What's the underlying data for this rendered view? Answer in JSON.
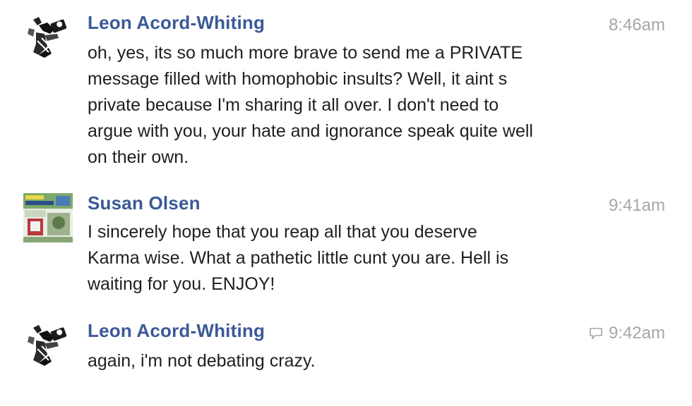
{
  "messages": [
    {
      "sender": "Leon Acord-Whiting",
      "time": "8:46am",
      "avatar_icon": "man-with-camera-icon",
      "lines": [
        "oh, yes, its so much more brave to send me a PRIVATE",
        "message filled with homophobic insults? Well, it aint s",
        "private because I'm sharing it all over. I don't need to",
        "argue with you, your hate and ignorance speak quite well",
        "on their own."
      ]
    },
    {
      "sender": "Susan Olsen",
      "time": "9:41am",
      "avatar_icon": "book-cover-photo-icon",
      "lines": [
        "I sincerely hope that you reap all that you deserve",
        "Karma wise. What a pathetic little cunt you are. Hell is",
        "waiting for you. ENJOY!"
      ]
    },
    {
      "sender": "Leon Acord-Whiting",
      "time": "9:42am",
      "avatar_icon": "man-with-camera-icon",
      "time_icon": "speech-bubble-icon",
      "lines": [
        "again, i'm not debating crazy."
      ]
    }
  ],
  "colors": {
    "sender_name": "#3b5998",
    "timestamp": "#a4a7ac",
    "message_text": "#1f1f1f"
  }
}
